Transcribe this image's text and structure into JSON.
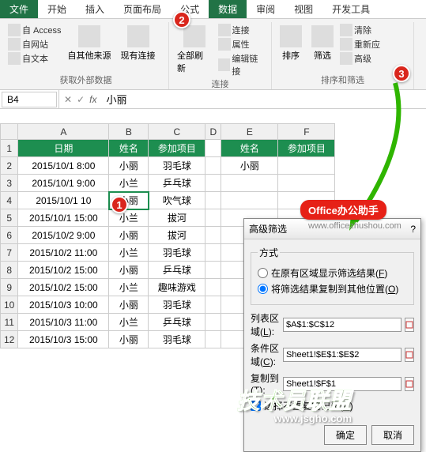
{
  "tabs": {
    "file": "文件",
    "home": "开始",
    "insert": "插入",
    "layout": "页面布局",
    "formula": "公式",
    "data": "数据",
    "review": "审阅",
    "view": "视图",
    "dev": "开发工具"
  },
  "ribbon": {
    "group1": {
      "access": "自 Access",
      "web": "自网站",
      "text": "自文本",
      "other": "自其他来源",
      "existing": "现有连接",
      "label": "获取外部数据"
    },
    "group2": {
      "refresh": "全部刷新",
      "conn": "连接",
      "prop": "属性",
      "editlink": "编辑链接",
      "label": "连接"
    },
    "group3": {
      "sort": "排序",
      "filter": "筛选",
      "clear": "清除",
      "reapply": "重新应",
      "advanced": "高级",
      "label": "排序和筛选"
    }
  },
  "namebox": "B4",
  "fx": "fx",
  "formula_value": "小丽",
  "cancel_icon": "✕",
  "check_icon": "✓",
  "columns": [
    "A",
    "B",
    "C",
    "D",
    "E",
    "F"
  ],
  "headers": {
    "date": "日期",
    "name": "姓名",
    "event": "参加项目"
  },
  "rows": [
    {
      "date": "2015/10/1 8:00",
      "name": "小丽",
      "event": "羽毛球"
    },
    {
      "date": "2015/10/1 9:00",
      "name": "小兰",
      "event": "乒乓球"
    },
    {
      "date": "2015/10/1 10",
      "name": "小丽",
      "event": "吹气球"
    },
    {
      "date": "2015/10/1 15:00",
      "name": "小兰",
      "event": "拔河"
    },
    {
      "date": "2015/10/2 9:00",
      "name": "小丽",
      "event": "拔河"
    },
    {
      "date": "2015/10/2 11:00",
      "name": "小兰",
      "event": "羽毛球"
    },
    {
      "date": "2015/10/2 15:00",
      "name": "小丽",
      "event": "乒乓球"
    },
    {
      "date": "2015/10/2 15:00",
      "name": "小兰",
      "event": "趣味游戏"
    },
    {
      "date": "2015/10/3 10:00",
      "name": "小丽",
      "event": "羽毛球"
    },
    {
      "date": "2015/10/3 11:00",
      "name": "小兰",
      "event": "乒乓球"
    },
    {
      "date": "2015/10/3 15:00",
      "name": "小丽",
      "event": "羽毛球"
    }
  ],
  "criteria": {
    "name": "小丽"
  },
  "dialog": {
    "title": "高级筛选",
    "url": "www.officezhushou.com",
    "method_legend": "方式",
    "radio1": "在原有区域显示筛选结果",
    "radio1_key": "F",
    "radio2": "将筛选结果复制到其他位置",
    "radio2_key": "O",
    "list_label": "列表区域",
    "list_key": "L",
    "list_val": "$A$1:$C$12",
    "cond_label": "条件区域",
    "cond_key": "C",
    "cond_val": "Sheet1!$E$1:$E$2",
    "copy_label": "复制到",
    "copy_key": "T",
    "copy_val": "Sheet1!$F$1",
    "unique": "选择不重复的记录",
    "unique_key": "R",
    "ok": "确定",
    "cancel": "取消"
  },
  "office_badge": "Office办公助手",
  "watermark": {
    "main": "技术员联盟",
    "sub": "www.jsgho.com"
  },
  "badges": {
    "b1": "1",
    "b2": "2",
    "b3": "3"
  },
  "colors": {
    "header": "#1d8e50",
    "badge": "#d9261c",
    "officebadge": "#e62117"
  }
}
